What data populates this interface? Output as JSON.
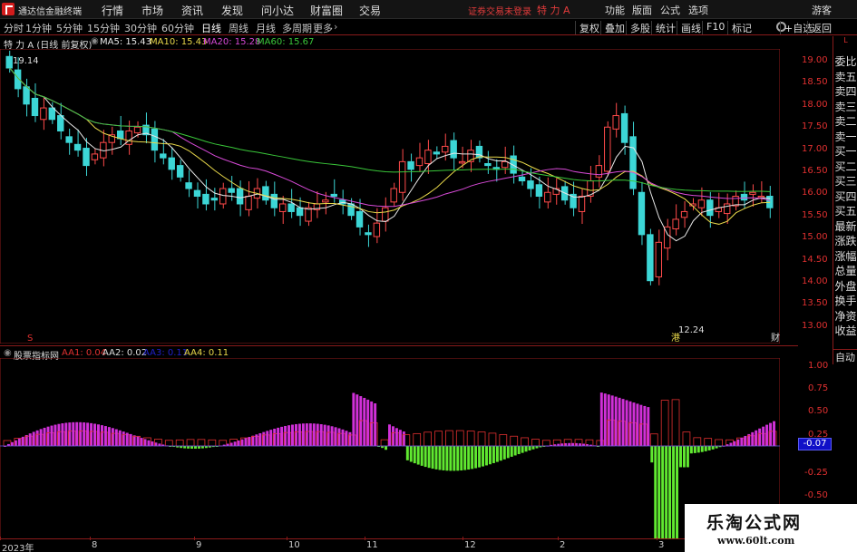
{
  "topbar": {
    "app_name": "通达信金融终端",
    "menu": [
      "行情",
      "市场",
      "资讯",
      "发现",
      "问小达",
      "财富圈",
      "交易"
    ],
    "notice": "证券交易未登录",
    "stock": "特 力 A",
    "right": [
      "功能",
      "版面",
      "公式",
      "选项"
    ],
    "guest": "游客"
  },
  "tabs": {
    "periods": [
      "分时",
      "1分钟",
      "5分钟",
      "15分钟",
      "30分钟",
      "60分钟",
      "日线",
      "周线",
      "月线",
      "多周期",
      "更多"
    ],
    "active": "日线",
    "right_buttons": [
      "复权",
      "叠加",
      "多股",
      "统计",
      "画线",
      "F10",
      "标记",
      "+自选",
      "返回"
    ]
  },
  "ma_legend": {
    "title": "特 力 A (日线 前复权)",
    "ma5": "MA5: 15.43",
    "ma10": "MA10: 15.43",
    "ma20": "MA20: 15.28",
    "ma60": "MA60: 15.67",
    "colors": {
      "ma5": "#e8e8e8",
      "ma10": "#e8d84a",
      "ma20": "#d84ad8",
      "ma60": "#3ac83a"
    }
  },
  "price_axis": [
    "19.00",
    "18.50",
    "18.00",
    "17.50",
    "17.00",
    "16.50",
    "16.00",
    "15.50",
    "15.00",
    "14.50",
    "14.00",
    "13.50",
    "13.00"
  ],
  "annotations": {
    "high": "19.14",
    "low": "12.24",
    "low_tag": "港",
    "news_tag": "财系",
    "start_tag": "S"
  },
  "indicator": {
    "name": "股票指标网",
    "aa1": "AA1: 0.04",
    "aa2": "AA2: 0.02",
    "aa3": "AA3: 0.11",
    "aa4": "AA4: 0.11",
    "axis": [
      "1.00",
      "0.75",
      "0.50",
      "0.25",
      "-0.25",
      "-0.50"
    ],
    "current": "-0.07"
  },
  "sidebar": [
    "委比",
    "卖五",
    "卖四",
    "卖三",
    "卖二",
    "卖一",
    "买一",
    "买二",
    "买三",
    "买四",
    "买五",
    "最新",
    "涨跌",
    "涨幅",
    "总量",
    "外盘",
    "换手",
    "净资",
    "收益"
  ],
  "sidebar_top": "L",
  "auto_label": "自动",
  "dates": [
    "2023年",
    "8",
    "9",
    "10",
    "11",
    "12",
    "2",
    "3"
  ],
  "watermark": {
    "line1": "乐淘公式网",
    "line2": "www.60lt.com"
  },
  "chart_data": {
    "type": "candlestick",
    "ylim": [
      12.2,
      19.4
    ],
    "closes": [
      19.14,
      18.6,
      18.2,
      17.9,
      18.1,
      17.8,
      17.5,
      17.2,
      17.0,
      16.6,
      16.9,
      17.2,
      17.4,
      17.3,
      17.5,
      17.6,
      17.4,
      17.0,
      16.8,
      16.5,
      16.3,
      16.0,
      15.8,
      15.6,
      15.7,
      16.0,
      15.9,
      15.6,
      15.8,
      16.0,
      15.7,
      15.5,
      15.6,
      15.4,
      15.3,
      15.5,
      15.6,
      15.7,
      15.8,
      15.6,
      15.3,
      15.0,
      14.8,
      15.1,
      15.5,
      16.0,
      16.7,
      16.5,
      16.8,
      17.0,
      16.9,
      17.1,
      16.8,
      16.7,
      17.0,
      16.8,
      16.6,
      16.5,
      16.7,
      16.4,
      16.2,
      16.0,
      15.8,
      15.9,
      16.0,
      15.7,
      15.5,
      15.8,
      16.2,
      16.6,
      17.6,
      17.9,
      17.2,
      16.0,
      14.8,
      13.6,
      14.6,
      15.0,
      15.2,
      15.4,
      15.6,
      15.7,
      15.3,
      15.5,
      15.6,
      15.8,
      15.7,
      15.9,
      15.8,
      15.5
    ]
  }
}
